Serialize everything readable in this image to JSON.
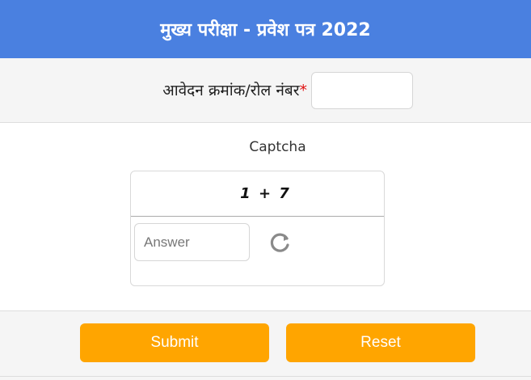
{
  "header": {
    "title": "मुख्य परीक्षा - प्रवेश पत्र  2022"
  },
  "form": {
    "application_label": "आवेदन क्रमांक/रोल नंबर",
    "required_marker": "*",
    "application_value": ""
  },
  "captcha": {
    "title": "Captcha",
    "question": "1 + 7",
    "answer_placeholder": "Answer",
    "refresh_icon": "refresh-icon"
  },
  "buttons": {
    "submit_label": "Submit",
    "reset_label": "Reset"
  },
  "colors": {
    "header_bg": "#4a80e0",
    "button_bg": "#ffa500",
    "required": "#e01010"
  }
}
